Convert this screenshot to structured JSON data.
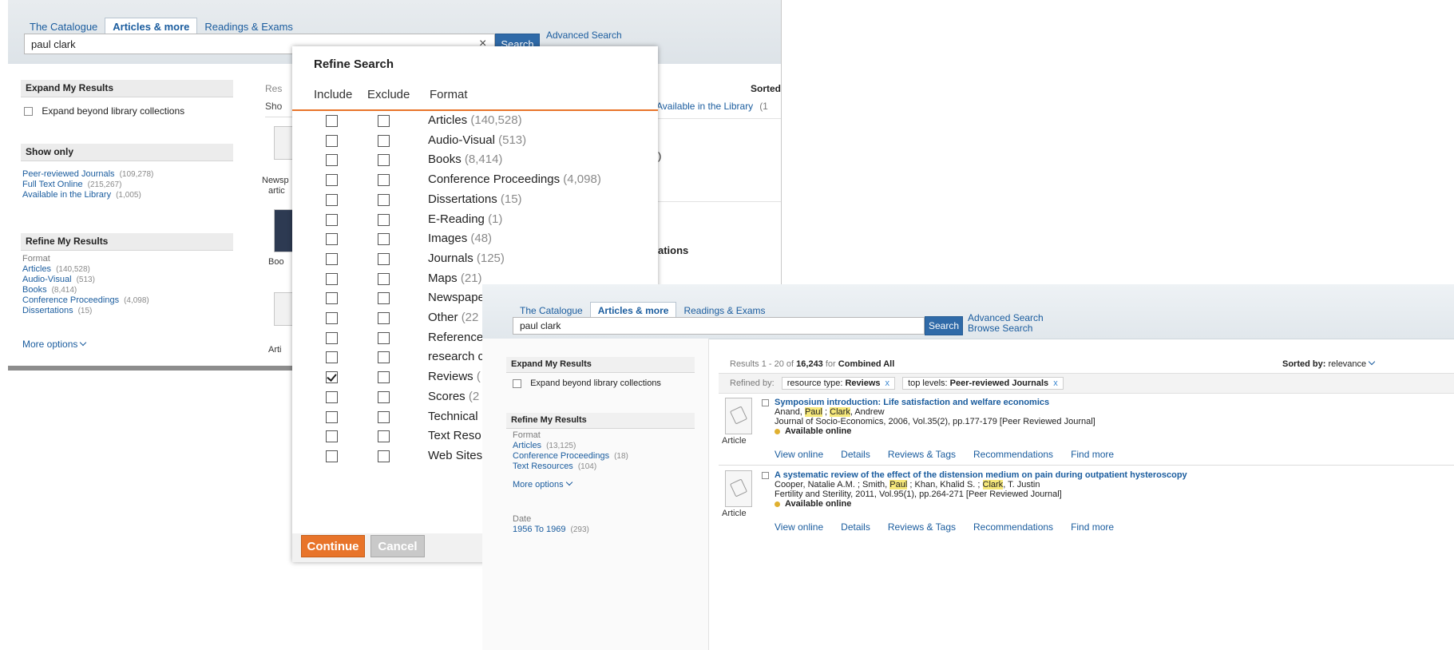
{
  "tabs": [
    "The Catalogue",
    "Articles & more",
    "Readings & Exams"
  ],
  "search_value": "paul clark",
  "search_button": "Search",
  "advanced_search": "Advanced Search",
  "browse_search": "Browse Search",
  "clear_icon": "×",
  "bg": {
    "expand_heading": "Expand My Results",
    "expand_label": "Expand beyond library collections",
    "show_only_heading": "Show only",
    "show_only": [
      {
        "label": "Peer-reviewed Journals",
        "count": "(109,278)"
      },
      {
        "label": "Full Text Online",
        "count": "(215,267)"
      },
      {
        "label": "Available in the Library",
        "count": "(1,005)"
      }
    ],
    "refine_heading": "Refine My Results",
    "format_label": "Format",
    "formats": [
      {
        "label": "Articles",
        "count": "(140,528)"
      },
      {
        "label": "Audio-Visual",
        "count": "(513)"
      },
      {
        "label": "Books",
        "count": "(8,414)"
      },
      {
        "label": "Conference Proceedings",
        "count": "(4,098)"
      },
      {
        "label": "Dissertations",
        "count": "(15)"
      }
    ],
    "more_options": "More options",
    "results_partial": "Res",
    "show_partial": "Sho",
    "sorted_partial": "Sorted",
    "available_partial": "Available in the Library",
    "available_count_partial": "(1",
    "newsp_partial": "Newsp",
    "artic_partial": "artic",
    "paren_partial": ")",
    "boo_partial": "Boo",
    "ations_partial": "ations",
    "arti_partial": "Arti"
  },
  "dialog": {
    "title": "Refine Search",
    "col_include": "Include",
    "col_exclude": "Exclude",
    "col_format": "Format",
    "options": [
      {
        "label": "Articles",
        "count": "(140,528)",
        "include": false
      },
      {
        "label": "Audio-Visual",
        "count": "(513)",
        "include": false
      },
      {
        "label": "Books",
        "count": "(8,414)",
        "include": false
      },
      {
        "label": "Conference Proceedings",
        "count": "(4,098)",
        "include": false
      },
      {
        "label": "Dissertations",
        "count": "(15)",
        "include": false
      },
      {
        "label": "E-Reading",
        "count": "(1)",
        "include": false
      },
      {
        "label": "Images",
        "count": "(48)",
        "include": false
      },
      {
        "label": "Journals",
        "count": "(125)",
        "include": false
      },
      {
        "label": "Maps",
        "count": "(21)",
        "include": false
      },
      {
        "label": "Newspape",
        "count": "",
        "include": false
      },
      {
        "label": "Other",
        "count": "(22",
        "include": false
      },
      {
        "label": "Reference",
        "count": "",
        "include": false
      },
      {
        "label": "research c",
        "count": "",
        "include": false
      },
      {
        "label": "Reviews",
        "count": "(",
        "include": true
      },
      {
        "label": "Scores",
        "count": "(2",
        "include": false
      },
      {
        "label": "Technical",
        "count": "",
        "include": false
      },
      {
        "label": "Text Reso",
        "count": "",
        "include": false
      },
      {
        "label": "Web Sites",
        "count": "",
        "include": false
      }
    ],
    "continue": "Continue",
    "cancel": "Cancel"
  },
  "fg": {
    "expand_heading": "Expand My Results",
    "expand_label": "Expand beyond library collections",
    "refine_heading": "Refine My Results",
    "format_label": "Format",
    "formats": [
      {
        "label": "Articles",
        "count": "(13,125)"
      },
      {
        "label": "Conference Proceedings",
        "count": "(18)"
      },
      {
        "label": "Text Resources",
        "count": "(104)"
      }
    ],
    "more_options": "More options",
    "date_label": "Date",
    "date_range": {
      "label": "1956 To 1969",
      "count": "(293)"
    },
    "results_prefix": "Results 1 - 20 of",
    "results_total": "16,243",
    "results_for": "for",
    "results_scope": "Combined All",
    "sorted_by": "Sorted by:",
    "sort_value": "relevance",
    "refined_by": "Refined by:",
    "filters": [
      {
        "key": "resource type:",
        "value": "Reviews",
        "remove": "x"
      },
      {
        "key": "top levels:",
        "value": "Peer-reviewed Journals",
        "remove": "x"
      }
    ],
    "results": [
      {
        "title": "Symposium introduction: Life satisfaction and welfare economics",
        "author_pre": "Anand,",
        "author_hl1": "Paul",
        "author_mid": ";",
        "author_hl2": "Clark",
        "author_post": ", Andrew",
        "source": "Journal of Socio-Economics, 2006, Vol.35(2), pp.177-179 [Peer Reviewed Journal]",
        "availability": "Available online",
        "kind": "Article"
      },
      {
        "title": "A systematic review of the effect of the distension medium on pain during outpatient hysteroscopy",
        "author_pre": "Cooper, Natalie A.M. ; Smith,",
        "author_hl1": "Paul",
        "author_mid": "; Khan, Khalid S. ;",
        "author_hl2": "Clark",
        "author_post": ", T. Justin",
        "source": "Fertility and Sterility, 2011, Vol.95(1), pp.264-271 [Peer Reviewed Journal]",
        "availability": "Available online",
        "kind": "Article"
      }
    ],
    "actions": [
      "View online",
      "Details",
      "Reviews & Tags",
      "Recommendations",
      "Find more"
    ]
  }
}
